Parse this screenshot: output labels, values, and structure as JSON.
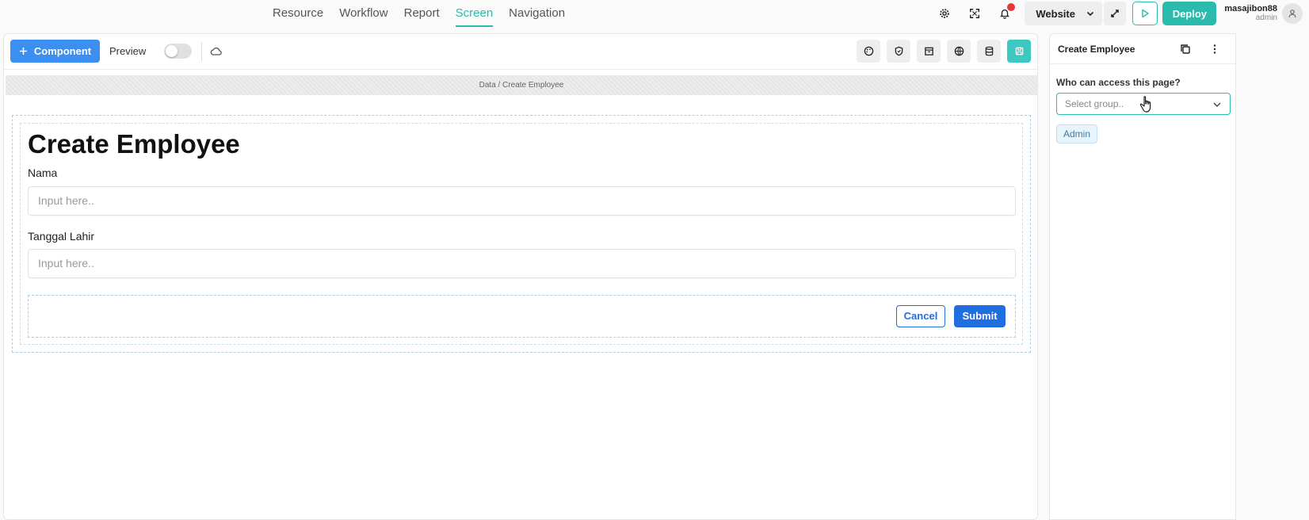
{
  "nav": {
    "items": [
      "Resource",
      "Workflow",
      "Report",
      "Screen",
      "Navigation"
    ],
    "active": "Screen"
  },
  "topbar": {
    "icons": [
      "gear-icon",
      "expand-icon",
      "bell-icon"
    ],
    "website_label": "Website",
    "deploy_label": "Deploy",
    "user_name": "masajibon88",
    "user_role": "admin",
    "accent_color": "#2bbbad",
    "notification_color": "#e53935"
  },
  "toolbar": {
    "component_label": "Component",
    "preview_label": "Preview",
    "preview_enabled": false,
    "right_icons": [
      "palette-icon",
      "shield-icon",
      "archive-icon",
      "globe-icon",
      "database-icon",
      "save-icon"
    ]
  },
  "canvas": {
    "breadcrumb": "Data / Create Employee",
    "form": {
      "title": "Create Employee",
      "fields": [
        {
          "label": "Nama",
          "placeholder": "Input here.."
        },
        {
          "label": "Tanggal Lahir",
          "placeholder": "Input here.."
        }
      ],
      "cancel_label": "Cancel",
      "submit_label": "Submit",
      "primary_color": "#1f6fe0"
    }
  },
  "right_panel": {
    "title": "Create Employee",
    "access_question": "Who can access this page?",
    "select_placeholder": "Select group..",
    "selected_groups": [
      "Admin"
    ]
  }
}
